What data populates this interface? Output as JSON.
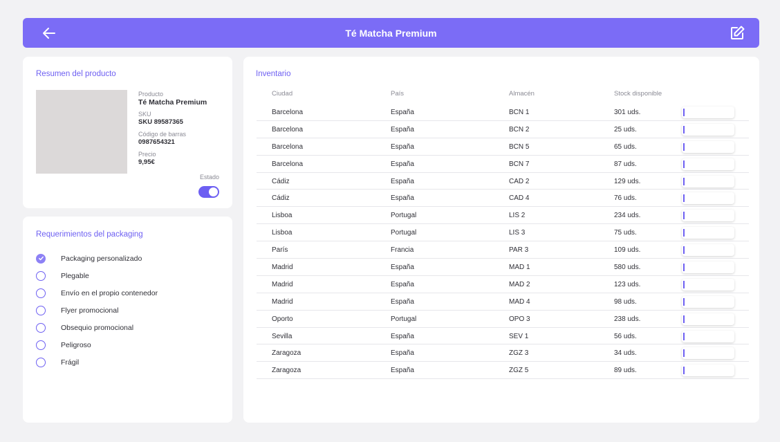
{
  "header": {
    "title": "Té Matcha Premium",
    "back_icon": "arrow-left-icon",
    "edit_icon": "edit-icon",
    "accent": "#7b6cf6"
  },
  "summary": {
    "title": "Resumen del producto",
    "product_label": "Producto",
    "product_value": "Té Matcha Premium",
    "sku_label": "SKU",
    "sku_value": "SKU 89587365",
    "barcode_label": "Código de barras",
    "barcode_value": "0987654321",
    "price_label": "Precio",
    "price_value": "9,95€",
    "status_label": "Estado",
    "status_on": true
  },
  "packaging": {
    "title": "Requerimientos del packaging",
    "items": [
      {
        "label": "Packaging personalizado",
        "checked": true
      },
      {
        "label": "Plegable",
        "checked": false
      },
      {
        "label": "Envío en el propio contenedor",
        "checked": false
      },
      {
        "label": "Flyer promocional",
        "checked": false
      },
      {
        "label": "Obsequio promocional",
        "checked": false
      },
      {
        "label": "Peligroso",
        "checked": false
      },
      {
        "label": "Frágil",
        "checked": false
      }
    ]
  },
  "inventory": {
    "title": "Inventario",
    "columns": [
      "Ciudad",
      "País",
      "Almacén",
      "Stock disponible"
    ],
    "rows": [
      {
        "city": "Barcelona",
        "country": "España",
        "warehouse": "BCN 1",
        "stock": "301 uds."
      },
      {
        "city": "Barcelona",
        "country": "España",
        "warehouse": "BCN 2",
        "stock": "25 uds."
      },
      {
        "city": "Barcelona",
        "country": "España",
        "warehouse": "BCN 5",
        "stock": "65 uds."
      },
      {
        "city": "Barcelona",
        "country": "España",
        "warehouse": "BCN 7",
        "stock": "87 uds."
      },
      {
        "city": "Cádiz",
        "country": "España",
        "warehouse": "CAD 2",
        "stock": "129 uds."
      },
      {
        "city": "Cádiz",
        "country": "España",
        "warehouse": "CAD 4",
        "stock": "76 uds."
      },
      {
        "city": "Lisboa",
        "country": "Portugal",
        "warehouse": "LIS 2",
        "stock": "234 uds."
      },
      {
        "city": "Lisboa",
        "country": "Portugal",
        "warehouse": "LIS 3",
        "stock": "75 uds."
      },
      {
        "city": "París",
        "country": "Francia",
        "warehouse": "PAR 3",
        "stock": "109 uds."
      },
      {
        "city": "Madrid",
        "country": "España",
        "warehouse": "MAD 1",
        "stock": "580 uds."
      },
      {
        "city": "Madrid",
        "country": "España",
        "warehouse": "MAD 2",
        "stock": "123 uds."
      },
      {
        "city": "Madrid",
        "country": "España",
        "warehouse": "MAD 4",
        "stock": "98 uds."
      },
      {
        "city": "Oporto",
        "country": "Portugal",
        "warehouse": "OPO 3",
        "stock": "238 uds."
      },
      {
        "city": "Sevilla",
        "country": "España",
        "warehouse": "SEV 1",
        "stock": "56 uds."
      },
      {
        "city": "Zaragoza",
        "country": "España",
        "warehouse": "ZGZ 3",
        "stock": "34 uds."
      },
      {
        "city": "Zaragoza",
        "country": "España",
        "warehouse": "ZGZ 5",
        "stock": "89 uds."
      }
    ]
  }
}
